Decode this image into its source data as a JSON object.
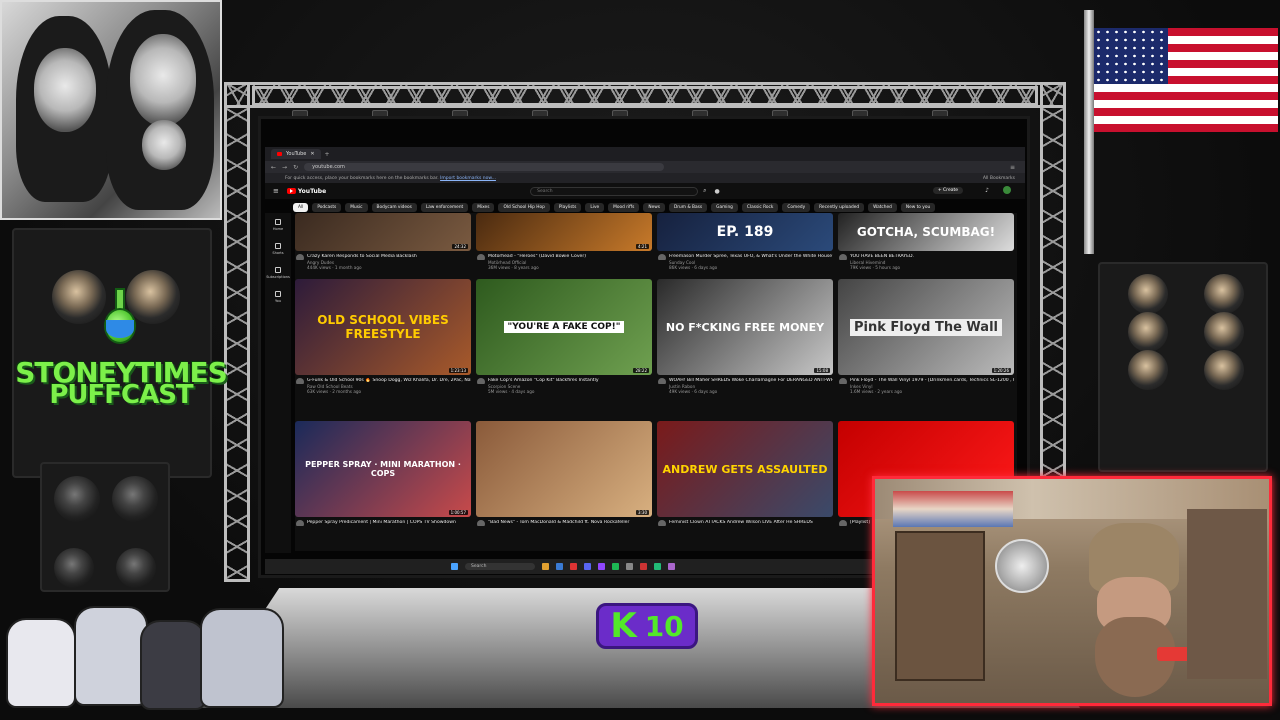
{
  "browser": {
    "tab_title": "YouTube",
    "url": "youtube.com",
    "bookmarks_prompt": "For quick access, place your bookmarks here on the bookmarks bar.",
    "bookmarks_link": "Import bookmarks now...",
    "all_bookmarks": "All Bookmarks"
  },
  "youtube": {
    "logo_text": "YouTube",
    "search_placeholder": "Search",
    "create_label": "+ Create",
    "chips": [
      "All",
      "Podcasts",
      "Music",
      "Bodycam videos",
      "Law enforcement",
      "Mixes",
      "Old School Hip Hop",
      "Playlists",
      "Live",
      "Mood riffs",
      "News",
      "Drum & Bass",
      "Gaming",
      "Classic Rock",
      "Comedy",
      "Recently uploaded",
      "Watched",
      "New to you"
    ],
    "sidebar": [
      "Home",
      "Shorts",
      "Subscriptions",
      "You"
    ],
    "rows": [
      [
        {
          "title": "Crazy Karen Responds to Social Media Backlash",
          "channel": "Angry Dudes",
          "meta": "444K views · 1 month ago",
          "duration": "24:32",
          "thumb_text": ""
        },
        {
          "title": "Motörhead - \"Heroes\" (David Bowie Cover)",
          "channel": "Motörhead Official",
          "meta": "36M views · 8 years ago",
          "duration": "4:21",
          "thumb_text": ""
        },
        {
          "title": "Freemason Murder Spree, Texas UFO, & What's Under the White House? | EP.189 | Ninjas Are Butterflies",
          "channel": "Sunday Cool",
          "meta": "86K views · 6 days ago",
          "duration": "",
          "thumb_text": "EP. 189"
        },
        {
          "title": "YOU HAVE BEEN BETRAYED.",
          "channel": "Liberal Hivemind",
          "meta": "79K views · 5 hours ago",
          "duration": "",
          "thumb_text": "GOTCHA, SCUMBAG!"
        }
      ],
      [
        {
          "title": "G-Funk & Old School 90s 🔥 Snoop Dogg, Wiz Khalifa, Dr. Dre, 2Pac, Nate Dogg, Ice Cube, Cover Style",
          "channel": "Raw Old School Beats",
          "meta": "63K views · 2 months ago",
          "duration": "1:23:13",
          "thumb_text": "OLD SCHOOL VIBES FREESTYLE"
        },
        {
          "title": "Fake Cop's Amazon \"Cop Kit\" Backfires Instantly",
          "channel": "Scorpion Scene",
          "meta": "5M views · 4 days ago",
          "duration": "28:22",
          "thumb_text": "\"YOU'RE A FAKE COP!\""
        },
        {
          "title": "WOAH! Bill Maher SHREDS Woke Charlamagne For DERANGED ANTI-WHITE Comments",
          "channel": "Justin Rabon",
          "meta": "49K views · 6 days ago",
          "duration": "15:08",
          "thumb_text": "NO F*CKING FREE MONEY"
        },
        {
          "title": "Pink Floyd - The Wall Vinyl 1979 - [Drinkmen.cards, Technics SL-1200 , Hana ML]",
          "channel": "Inkes Vinyl",
          "meta": "1.6M views · 2 years ago",
          "duration": "1:20:26",
          "thumb_text": "Pink Floyd The Wall"
        }
      ],
      [
        {
          "title": "Pepper Spray Predicament | Mini Marathon | COPS TV Showdown",
          "channel": "",
          "meta": "",
          "duration": "1:00:57",
          "thumb_text": "PEPPER SPRAY · MINI MARATHON · COPS"
        },
        {
          "title": "\"Bad News\" - Tom MacDonald & Madchild ft. Nova Rockafeller",
          "channel": "",
          "meta": "",
          "duration": "3:30",
          "thumb_text": ""
        },
        {
          "title": "Feminist Clown ATTACKS Andrew Wilson LIVE After He SHREDS",
          "channel": "",
          "meta": "",
          "duration": "",
          "thumb_text": "ANDREW GETS ASSAULTED"
        },
        {
          "title": "[Playlist]",
          "channel": "",
          "meta": "",
          "duration": "",
          "thumb_text": ""
        }
      ]
    ]
  },
  "taskbar": {
    "search_placeholder": "Search"
  },
  "overlay": {
    "logo_line1": "STONEYTIMES",
    "logo_line2": "PUFFCAST",
    "badge_letter": "K",
    "badge_number": "10"
  }
}
